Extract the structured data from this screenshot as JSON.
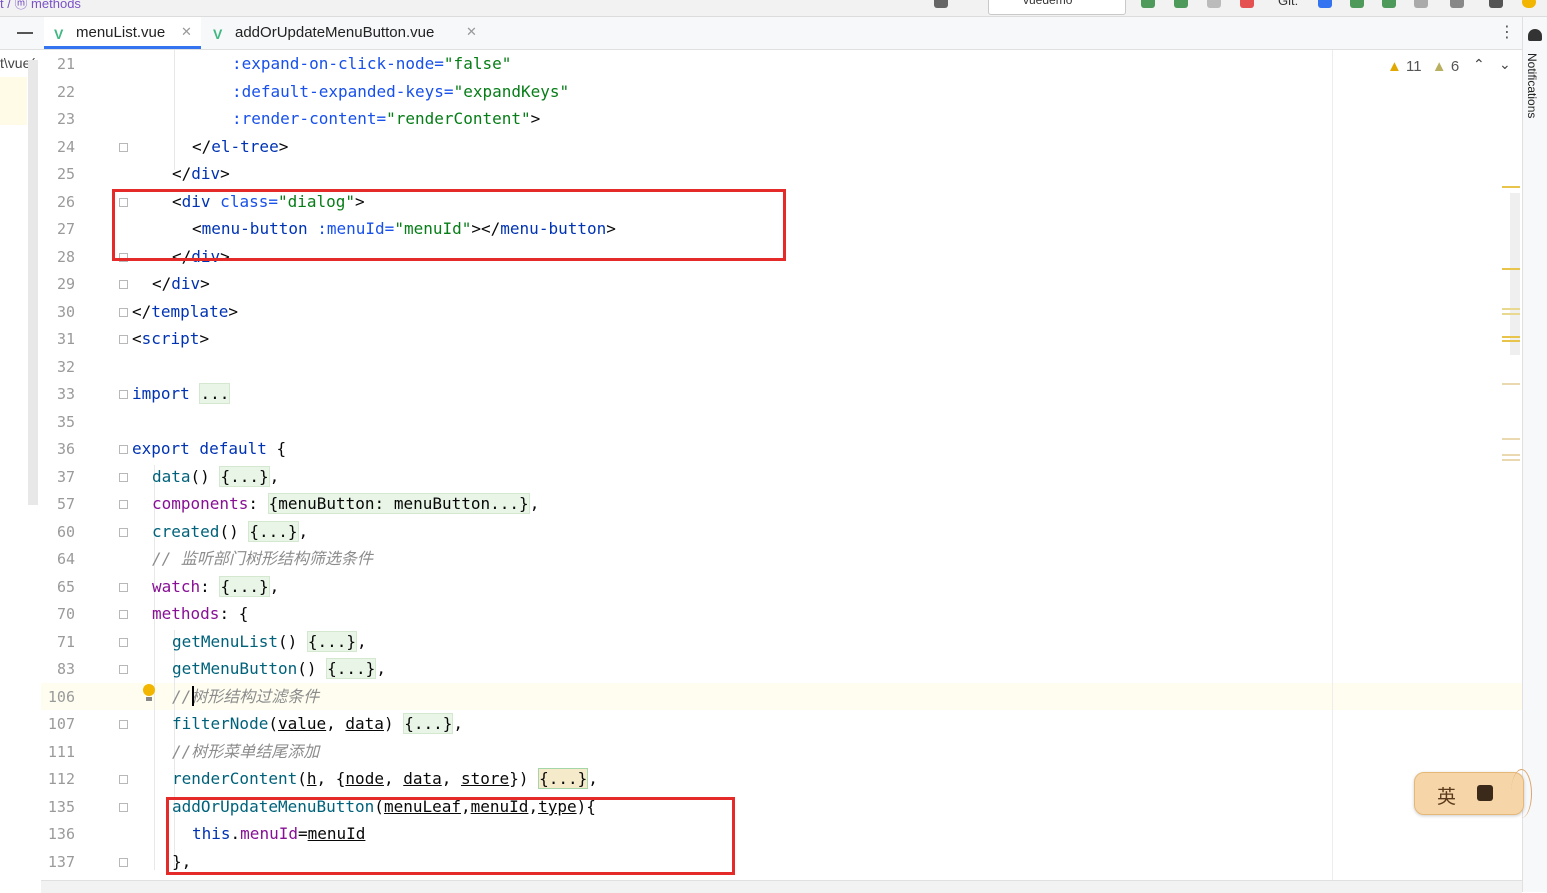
{
  "topbar": {
    "breadcrumb": "t / ⓜ methods",
    "run_config": "vuedemo",
    "git_label": "Git:"
  },
  "tabs": [
    {
      "label": "menuList.vue",
      "active": true
    },
    {
      "label": "addOrUpdateMenuButton.vue",
      "active": false
    }
  ],
  "project_panel": {
    "path_fragment": "t\\vue("
  },
  "inspections": {
    "warnings": "11",
    "weak_warnings": "6"
  },
  "notifications_label": "Notifications",
  "ime": {
    "label": "英"
  },
  "lines": [
    {
      "num": "21",
      "indent": 5,
      "parts": [
        {
          "t": ":expand-on-click-node=",
          "c": "attr"
        },
        {
          "t": "\"false\"",
          "c": "str"
        }
      ]
    },
    {
      "num": "22",
      "indent": 5,
      "parts": [
        {
          "t": ":default-expanded-keys=",
          "c": "attr"
        },
        {
          "t": "\"expandKeys\"",
          "c": "str"
        }
      ]
    },
    {
      "num": "23",
      "indent": 5,
      "parts": [
        {
          "t": ":render-content=",
          "c": "attr"
        },
        {
          "t": "\"renderContent\"",
          "c": "str"
        },
        {
          "t": ">",
          "c": ""
        }
      ]
    },
    {
      "num": "24",
      "indent": 3,
      "parts": [
        {
          "t": "</",
          "c": ""
        },
        {
          "t": "el-tree",
          "c": "tag"
        },
        {
          "t": ">",
          "c": ""
        }
      ]
    },
    {
      "num": "25",
      "indent": 2,
      "parts": [
        {
          "t": "</",
          "c": ""
        },
        {
          "t": "div",
          "c": "tag"
        },
        {
          "t": ">",
          "c": ""
        }
      ]
    },
    {
      "num": "26",
      "indent": 2,
      "parts": [
        {
          "t": "<",
          "c": ""
        },
        {
          "t": "div",
          "c": "tag"
        },
        {
          "t": " class=",
          "c": "attr"
        },
        {
          "t": "\"dialog\"",
          "c": "str"
        },
        {
          "t": ">",
          "c": ""
        }
      ]
    },
    {
      "num": "27",
      "indent": 3,
      "parts": [
        {
          "t": "<",
          "c": ""
        },
        {
          "t": "menu-button",
          "c": "tag"
        },
        {
          "t": " :menuId=",
          "c": "attr"
        },
        {
          "t": "\"menuId\"",
          "c": "str"
        },
        {
          "t": "></",
          "c": ""
        },
        {
          "t": "menu-button",
          "c": "tag"
        },
        {
          "t": ">",
          "c": ""
        }
      ]
    },
    {
      "num": "28",
      "indent": 2,
      "parts": [
        {
          "t": "</",
          "c": ""
        },
        {
          "t": "div",
          "c": "tag"
        },
        {
          "t": ">",
          "c": ""
        }
      ]
    },
    {
      "num": "29",
      "indent": 1,
      "parts": [
        {
          "t": "</",
          "c": ""
        },
        {
          "t": "div",
          "c": "tag"
        },
        {
          "t": ">",
          "c": ""
        }
      ]
    },
    {
      "num": "30",
      "indent": 0,
      "parts": [
        {
          "t": "</",
          "c": ""
        },
        {
          "t": "template",
          "c": "tag"
        },
        {
          "t": ">",
          "c": ""
        }
      ]
    },
    {
      "num": "31",
      "indent": 0,
      "parts": [
        {
          "t": "<",
          "c": ""
        },
        {
          "t": "script",
          "c": "tag"
        },
        {
          "t": ">",
          "c": ""
        }
      ]
    },
    {
      "num": "32",
      "indent": 0,
      "parts": []
    },
    {
      "num": "33",
      "indent": 0,
      "parts": [
        {
          "t": "import",
          "c": "kw"
        },
        {
          "t": " ",
          "c": ""
        },
        {
          "t": "...",
          "c": "fld"
        }
      ]
    },
    {
      "num": "35",
      "indent": 0,
      "parts": []
    },
    {
      "num": "36",
      "indent": 0,
      "parts": [
        {
          "t": "export default",
          "c": "kw"
        },
        {
          "t": " {",
          "c": ""
        }
      ]
    },
    {
      "num": "37",
      "indent": 1,
      "parts": [
        {
          "t": "data",
          "c": "fn"
        },
        {
          "t": "() ",
          "c": ""
        },
        {
          "t": "{...}",
          "c": "fld"
        },
        {
          "t": ",",
          "c": ""
        }
      ]
    },
    {
      "num": "57",
      "indent": 1,
      "parts": [
        {
          "t": "components",
          "c": "prop"
        },
        {
          "t": ": ",
          "c": ""
        },
        {
          "t": "{menuButton: menuButton...}",
          "c": "fld"
        },
        {
          "t": ",",
          "c": ""
        }
      ]
    },
    {
      "num": "60",
      "indent": 1,
      "parts": [
        {
          "t": "created",
          "c": "fn"
        },
        {
          "t": "() ",
          "c": ""
        },
        {
          "t": "{...}",
          "c": "fld"
        },
        {
          "t": ",",
          "c": ""
        }
      ]
    },
    {
      "num": "64",
      "indent": 1,
      "parts": [
        {
          "t": "// 监听部门树形结构筛选条件",
          "c": "cmt"
        }
      ]
    },
    {
      "num": "65",
      "indent": 1,
      "parts": [
        {
          "t": "watch",
          "c": "prop"
        },
        {
          "t": ": ",
          "c": ""
        },
        {
          "t": "{...}",
          "c": "fld"
        },
        {
          "t": ",",
          "c": ""
        }
      ]
    },
    {
      "num": "70",
      "indent": 1,
      "parts": [
        {
          "t": "methods",
          "c": "prop"
        },
        {
          "t": ": {",
          "c": ""
        }
      ]
    },
    {
      "num": "71",
      "indent": 2,
      "parts": [
        {
          "t": "getMenuList",
          "c": "fn"
        },
        {
          "t": "() ",
          "c": ""
        },
        {
          "t": "{...}",
          "c": "fld"
        },
        {
          "t": ",",
          "c": ""
        }
      ]
    },
    {
      "num": "83",
      "indent": 2,
      "parts": [
        {
          "t": "getMenuButton",
          "c": "fn"
        },
        {
          "t": "() ",
          "c": ""
        },
        {
          "t": "{...}",
          "c": "fld"
        },
        {
          "t": ",",
          "c": ""
        }
      ]
    },
    {
      "num": "106",
      "indent": 2,
      "parts": [
        {
          "t": "//树形结构过滤条件",
          "c": "cmt"
        }
      ]
    },
    {
      "num": "107",
      "indent": 2,
      "parts": [
        {
          "t": "filterNode",
          "c": "fn"
        },
        {
          "t": "(",
          "c": ""
        },
        {
          "t": "value",
          "c": "ul"
        },
        {
          "t": ", ",
          "c": ""
        },
        {
          "t": "data",
          "c": "ul"
        },
        {
          "t": ") ",
          "c": ""
        },
        {
          "t": "{...}",
          "c": "fld"
        },
        {
          "t": ",",
          "c": ""
        }
      ]
    },
    {
      "num": "111",
      "indent": 2,
      "parts": [
        {
          "t": "//树形菜单结尾添加",
          "c": "cmt"
        }
      ]
    },
    {
      "num": "112",
      "indent": 2,
      "parts": [
        {
          "t": "renderContent",
          "c": "fn"
        },
        {
          "t": "(",
          "c": ""
        },
        {
          "t": "h",
          "c": "ul"
        },
        {
          "t": ", {",
          "c": ""
        },
        {
          "t": "node",
          "c": "ul"
        },
        {
          "t": ", ",
          "c": ""
        },
        {
          "t": "data",
          "c": "ul"
        },
        {
          "t": ", ",
          "c": ""
        },
        {
          "t": "store",
          "c": "ul"
        },
        {
          "t": "}) ",
          "c": ""
        },
        {
          "t": "{...}",
          "c": "fld-sel"
        },
        {
          "t": ",",
          "c": ""
        }
      ]
    },
    {
      "num": "135",
      "indent": 2,
      "parts": [
        {
          "t": "addOrUpdateMenuButton",
          "c": "fn"
        },
        {
          "t": "(",
          "c": ""
        },
        {
          "t": "menuLeaf",
          "c": "ul"
        },
        {
          "t": ",",
          "c": ""
        },
        {
          "t": "menuId",
          "c": "ul"
        },
        {
          "t": ",",
          "c": ""
        },
        {
          "t": "type",
          "c": "ul"
        },
        {
          "t": "){",
          "c": ""
        }
      ]
    },
    {
      "num": "136",
      "indent": 3,
      "parts": [
        {
          "t": "this",
          "c": "kw"
        },
        {
          "t": ".",
          "c": ""
        },
        {
          "t": "menuId",
          "c": "prop"
        },
        {
          "t": "=",
          "c": ""
        },
        {
          "t": "menuId",
          "c": "ul"
        }
      ]
    },
    {
      "num": "137",
      "indent": 2,
      "parts": [
        {
          "t": "},",
          "c": ""
        }
      ]
    }
  ]
}
